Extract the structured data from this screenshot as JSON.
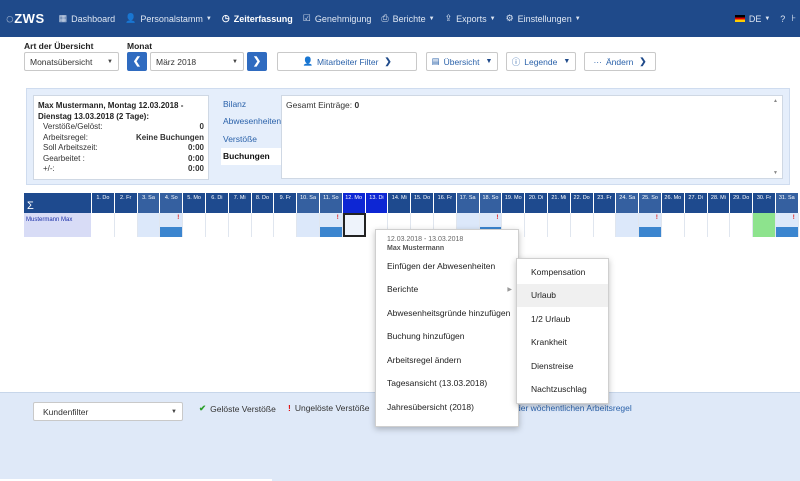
{
  "nav": {
    "logo": "ZWS",
    "items": [
      {
        "icon": "grid-icon",
        "glyph": "▦",
        "label": "Dashboard",
        "caret": false
      },
      {
        "icon": "user-icon",
        "glyph": "👤",
        "label": "Personalstamm",
        "caret": true
      },
      {
        "icon": "clock-icon",
        "glyph": "◷",
        "label": "Zeiterfassung",
        "caret": false,
        "active": true
      },
      {
        "icon": "check-square-icon",
        "glyph": "☑",
        "label": "Genehmigung",
        "caret": false
      },
      {
        "icon": "print-icon",
        "glyph": "⎙",
        "label": "Berichte",
        "caret": true
      },
      {
        "icon": "export-icon",
        "glyph": "⇪",
        "label": "Exports",
        "caret": true
      },
      {
        "icon": "gear-icon",
        "glyph": "⚙",
        "label": "Einstellungen",
        "caret": true
      }
    ],
    "lang": "DE",
    "help": "?"
  },
  "filters": {
    "art_label": "Art der Übersicht",
    "art_value": "Monatsübersicht",
    "monat_label": "Monat",
    "monat_value": "März 2018",
    "mitarbeiter_filter": "Mitarbeiter Filter",
    "uebersicht": "Übersicht",
    "legende": "Legende",
    "aendern": "Ändern"
  },
  "info": {
    "title": "Max Mustermann, Montag 12.03.2018 - Dienstag 13.03.2018 (2 Tage):",
    "rows": [
      {
        "label": "Verstöße/Gelöst:",
        "value": "0"
      },
      {
        "label": "Arbeitsregel:",
        "value": "Keine Buchungen"
      },
      {
        "label": "Soll Arbeitszeit:",
        "value": "0:00"
      },
      {
        "label": "Gearbeitet :",
        "value": "0:00"
      },
      {
        "label": "+/-:",
        "value": "0:00"
      }
    ],
    "tabs": [
      "Bilanz",
      "Abwesenheiten",
      "Verstöße",
      "Buchungen"
    ],
    "selected_tab": 3,
    "detail_label": "Gesamt Einträge:",
    "detail_value": "0"
  },
  "calendar": {
    "sigma": "Σ",
    "employee": "Mustermann Max",
    "days": [
      {
        "label": "1. Do"
      },
      {
        "label": "2. Fr"
      },
      {
        "label": "3. Sa",
        "weekend": true
      },
      {
        "label": "4. So",
        "weekend": true,
        "flag": "!",
        "bar": true
      },
      {
        "label": "5. Mo"
      },
      {
        "label": "6. Di"
      },
      {
        "label": "7. Mi"
      },
      {
        "label": "8. Do"
      },
      {
        "label": "9. Fr"
      },
      {
        "label": "10. Sa",
        "weekend": true
      },
      {
        "label": "11. So",
        "weekend": true,
        "flag": "!",
        "bar": true
      },
      {
        "label": "12. Mo",
        "selected": true,
        "focus": true
      },
      {
        "label": "13. Di",
        "selected": true
      },
      {
        "label": "14. Mi"
      },
      {
        "label": "15. Do"
      },
      {
        "label": "16. Fr"
      },
      {
        "label": "17. Sa",
        "weekend": true
      },
      {
        "label": "18. So",
        "weekend": true,
        "flag": "!",
        "bar": true
      },
      {
        "label": "19. Mo"
      },
      {
        "label": "20. Di"
      },
      {
        "label": "21. Mi"
      },
      {
        "label": "22. Do"
      },
      {
        "label": "23. Fr"
      },
      {
        "label": "24. Sa",
        "weekend": true
      },
      {
        "label": "25. So",
        "weekend": true,
        "flag": "!",
        "bar": true
      },
      {
        "label": "26. Mo"
      },
      {
        "label": "27. Di"
      },
      {
        "label": "28. Mi"
      },
      {
        "label": "29. Do"
      },
      {
        "label": "30. Fr",
        "green": true
      },
      {
        "label": "31. Sa",
        "weekend": true,
        "flag": "!",
        "bar": true
      }
    ]
  },
  "bottom": {
    "kundenfilter": "Kundenfilter",
    "geloest": "Gelöste Verstöße",
    "ungeloest": "Ungelöste Verstöße",
    "hint": "der wöchentlichen Arbeitsregel"
  },
  "context_menu": {
    "date_range": "12.03.2018 - 13.03.2018",
    "employee": "Max Mustermann",
    "items": [
      {
        "label": "Einfügen der Abwesenheiten"
      },
      {
        "label": "Berichte",
        "submenu": true
      },
      {
        "label": "Abwesenheitsgründe hinzufügen"
      },
      {
        "label": "Buchung hinzufügen"
      },
      {
        "label": "Arbeitsregel ändern"
      },
      {
        "label": "Tagesansicht (13.03.2018)"
      },
      {
        "label": "Jahresübersicht (2018)"
      }
    ]
  },
  "submenu": {
    "items": [
      "Kompensation",
      "Urlaub",
      "1/2 Urlaub",
      "Krankheit",
      "Dienstreise",
      "Nachtzuschlag"
    ],
    "hover_index": 1
  }
}
